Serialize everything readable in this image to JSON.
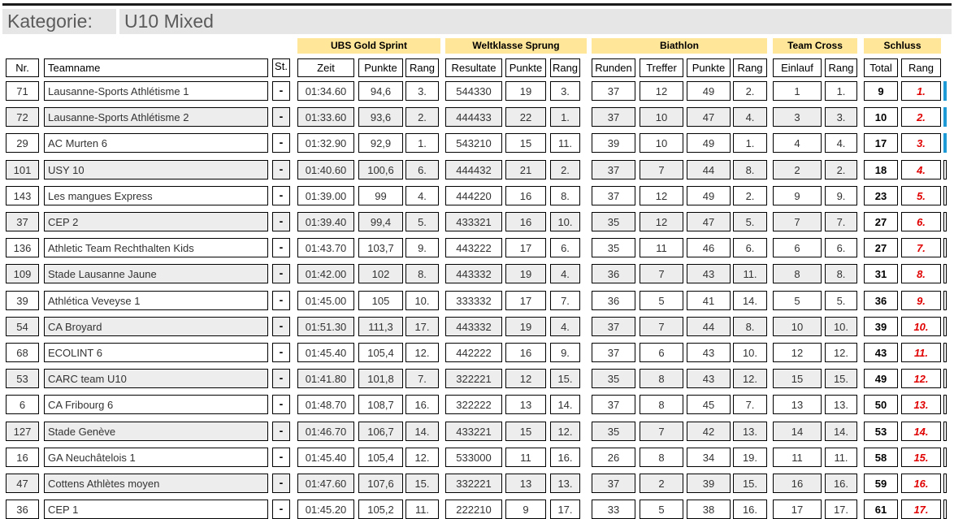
{
  "category": {
    "label": "Kategorie:",
    "value": "U10 Mixed"
  },
  "groups": [
    "UBS Gold Sprint",
    "Weltklasse Sprung",
    "Biathlon",
    "Team Cross",
    "Schluss"
  ],
  "columns": [
    "Nr.",
    "Teamname",
    "St.",
    "Zeit",
    "Punkte",
    "Rang",
    "Resultate",
    "Punkte",
    "Rang",
    "Runden",
    "Treffer",
    "Punkte",
    "Rang",
    "Einlauf",
    "Rang",
    "Total",
    "Rang"
  ],
  "colors": {
    "group_header": "#ffe699",
    "category_bg": "#e7e6e6",
    "alt_row": "#ededed",
    "rank_red": "#e00000",
    "marker_blue": "#1e9bd7"
  },
  "rows": [
    {
      "nr": "71",
      "team": "Lausanne-Sports Athlétisme 1",
      "st": "-",
      "zeit": "01:34.60",
      "sp_punkte": "94,6",
      "sp_rang": "3.",
      "resultate": "544330",
      "ws_punkte": "19",
      "ws_rang": "3.",
      "runden": "37",
      "treffer": "12",
      "bi_punkte": "49",
      "bi_rang": "2.",
      "einlauf": "1",
      "tc_rang": "1.",
      "total": "9",
      "rang": "1.",
      "marker": "blue"
    },
    {
      "nr": "72",
      "team": "Lausanne-Sports Athlétisme 2",
      "st": "-",
      "zeit": "01:33.60",
      "sp_punkte": "93,6",
      "sp_rang": "2.",
      "resultate": "444433",
      "ws_punkte": "22",
      "ws_rang": "1.",
      "runden": "37",
      "treffer": "10",
      "bi_punkte": "47",
      "bi_rang": "4.",
      "einlauf": "3",
      "tc_rang": "3.",
      "total": "10",
      "rang": "2.",
      "marker": "blue"
    },
    {
      "nr": "29",
      "team": "AC Murten 6",
      "st": "-",
      "zeit": "01:32.90",
      "sp_punkte": "92,9",
      "sp_rang": "1.",
      "resultate": "543210",
      "ws_punkte": "15",
      "ws_rang": "11.",
      "runden": "39",
      "treffer": "10",
      "bi_punkte": "49",
      "bi_rang": "1.",
      "einlauf": "4",
      "tc_rang": "4.",
      "total": "17",
      "rang": "3.",
      "marker": "blue"
    },
    {
      "nr": "101",
      "team": "USY 10",
      "st": "-",
      "zeit": "01:40.60",
      "sp_punkte": "100,6",
      "sp_rang": "6.",
      "resultate": "444432",
      "ws_punkte": "21",
      "ws_rang": "2.",
      "runden": "37",
      "treffer": "7",
      "bi_punkte": "44",
      "bi_rang": "8.",
      "einlauf": "2",
      "tc_rang": "2.",
      "total": "18",
      "rang": "4.",
      "marker": "none"
    },
    {
      "nr": "143",
      "team": "Les mangues Express",
      "st": "-",
      "zeit": "01:39.00",
      "sp_punkte": "99",
      "sp_rang": "4.",
      "resultate": "444220",
      "ws_punkte": "16",
      "ws_rang": "8.",
      "runden": "37",
      "treffer": "12",
      "bi_punkte": "49",
      "bi_rang": "2.",
      "einlauf": "9",
      "tc_rang": "9.",
      "total": "23",
      "rang": "5.",
      "marker": "none"
    },
    {
      "nr": "37",
      "team": "CEP 2",
      "st": "-",
      "zeit": "01:39.40",
      "sp_punkte": "99,4",
      "sp_rang": "5.",
      "resultate": "433321",
      "ws_punkte": "16",
      "ws_rang": "10.",
      "runden": "35",
      "treffer": "12",
      "bi_punkte": "47",
      "bi_rang": "5.",
      "einlauf": "7",
      "tc_rang": "7.",
      "total": "27",
      "rang": "6.",
      "marker": "none"
    },
    {
      "nr": "136",
      "team": "Athletic Team Rechthalten Kids",
      "st": "-",
      "zeit": "01:43.70",
      "sp_punkte": "103,7",
      "sp_rang": "9.",
      "resultate": "443222",
      "ws_punkte": "17",
      "ws_rang": "6.",
      "runden": "35",
      "treffer": "11",
      "bi_punkte": "46",
      "bi_rang": "6.",
      "einlauf": "6",
      "tc_rang": "6.",
      "total": "27",
      "rang": "7.",
      "marker": "none"
    },
    {
      "nr": "109",
      "team": "Stade Lausanne Jaune",
      "st": "-",
      "zeit": "01:42.00",
      "sp_punkte": "102",
      "sp_rang": "8.",
      "resultate": "443332",
      "ws_punkte": "19",
      "ws_rang": "4.",
      "runden": "36",
      "treffer": "7",
      "bi_punkte": "43",
      "bi_rang": "11.",
      "einlauf": "8",
      "tc_rang": "8.",
      "total": "31",
      "rang": "8.",
      "marker": "none"
    },
    {
      "nr": "39",
      "team": "Athlética Veveyse 1",
      "st": "-",
      "zeit": "01:45.00",
      "sp_punkte": "105",
      "sp_rang": "10.",
      "resultate": "333332",
      "ws_punkte": "17",
      "ws_rang": "7.",
      "runden": "36",
      "treffer": "5",
      "bi_punkte": "41",
      "bi_rang": "14.",
      "einlauf": "5",
      "tc_rang": "5.",
      "total": "36",
      "rang": "9.",
      "marker": "none"
    },
    {
      "nr": "54",
      "team": "CA Broyard",
      "st": "-",
      "zeit": "01:51.30",
      "sp_punkte": "111,3",
      "sp_rang": "17.",
      "resultate": "443332",
      "ws_punkte": "19",
      "ws_rang": "4.",
      "runden": "37",
      "treffer": "7",
      "bi_punkte": "44",
      "bi_rang": "8.",
      "einlauf": "10",
      "tc_rang": "10.",
      "total": "39",
      "rang": "10.",
      "marker": "none"
    },
    {
      "nr": "68",
      "team": "ECOLINT 6",
      "st": "-",
      "zeit": "01:45.40",
      "sp_punkte": "105,4",
      "sp_rang": "12.",
      "resultate": "442222",
      "ws_punkte": "16",
      "ws_rang": "9.",
      "runden": "37",
      "treffer": "6",
      "bi_punkte": "43",
      "bi_rang": "10.",
      "einlauf": "12",
      "tc_rang": "12.",
      "total": "43",
      "rang": "11.",
      "marker": "none"
    },
    {
      "nr": "53",
      "team": "CARC team U10",
      "st": "-",
      "zeit": "01:41.80",
      "sp_punkte": "101,8",
      "sp_rang": "7.",
      "resultate": "322221",
      "ws_punkte": "12",
      "ws_rang": "15.",
      "runden": "35",
      "treffer": "8",
      "bi_punkte": "43",
      "bi_rang": "12.",
      "einlauf": "15",
      "tc_rang": "15.",
      "total": "49",
      "rang": "12.",
      "marker": "none"
    },
    {
      "nr": "6",
      "team": "CA Fribourg 6",
      "st": "-",
      "zeit": "01:48.70",
      "sp_punkte": "108,7",
      "sp_rang": "16.",
      "resultate": "322222",
      "ws_punkte": "13",
      "ws_rang": "14.",
      "runden": "37",
      "treffer": "8",
      "bi_punkte": "45",
      "bi_rang": "7.",
      "einlauf": "13",
      "tc_rang": "13.",
      "total": "50",
      "rang": "13.",
      "marker": "none"
    },
    {
      "nr": "127",
      "team": "Stade Genève",
      "st": "-",
      "zeit": "01:46.70",
      "sp_punkte": "106,7",
      "sp_rang": "14.",
      "resultate": "433221",
      "ws_punkte": "15",
      "ws_rang": "12.",
      "runden": "35",
      "treffer": "7",
      "bi_punkte": "42",
      "bi_rang": "13.",
      "einlauf": "14",
      "tc_rang": "14.",
      "total": "53",
      "rang": "14.",
      "marker": "none"
    },
    {
      "nr": "16",
      "team": "GA Neuchâtelois 1",
      "st": "-",
      "zeit": "01:45.40",
      "sp_punkte": "105,4",
      "sp_rang": "12.",
      "resultate": "533000",
      "ws_punkte": "11",
      "ws_rang": "16.",
      "runden": "26",
      "treffer": "8",
      "bi_punkte": "34",
      "bi_rang": "19.",
      "einlauf": "11",
      "tc_rang": "11.",
      "total": "58",
      "rang": "15.",
      "marker": "none"
    },
    {
      "nr": "47",
      "team": "Cottens Athlètes moyen",
      "st": "-",
      "zeit": "01:47.60",
      "sp_punkte": "107,6",
      "sp_rang": "15.",
      "resultate": "332221",
      "ws_punkte": "13",
      "ws_rang": "13.",
      "runden": "37",
      "treffer": "2",
      "bi_punkte": "39",
      "bi_rang": "15.",
      "einlauf": "16",
      "tc_rang": "16.",
      "total": "59",
      "rang": "16.",
      "marker": "none"
    },
    {
      "nr": "36",
      "team": "CEP 1",
      "st": "-",
      "zeit": "01:45.20",
      "sp_punkte": "105,2",
      "sp_rang": "11.",
      "resultate": "222210",
      "ws_punkte": "9",
      "ws_rang": "17.",
      "runden": "33",
      "treffer": "5",
      "bi_punkte": "38",
      "bi_rang": "16.",
      "einlauf": "17",
      "tc_rang": "17.",
      "total": "61",
      "rang": "17.",
      "marker": "none"
    }
  ]
}
